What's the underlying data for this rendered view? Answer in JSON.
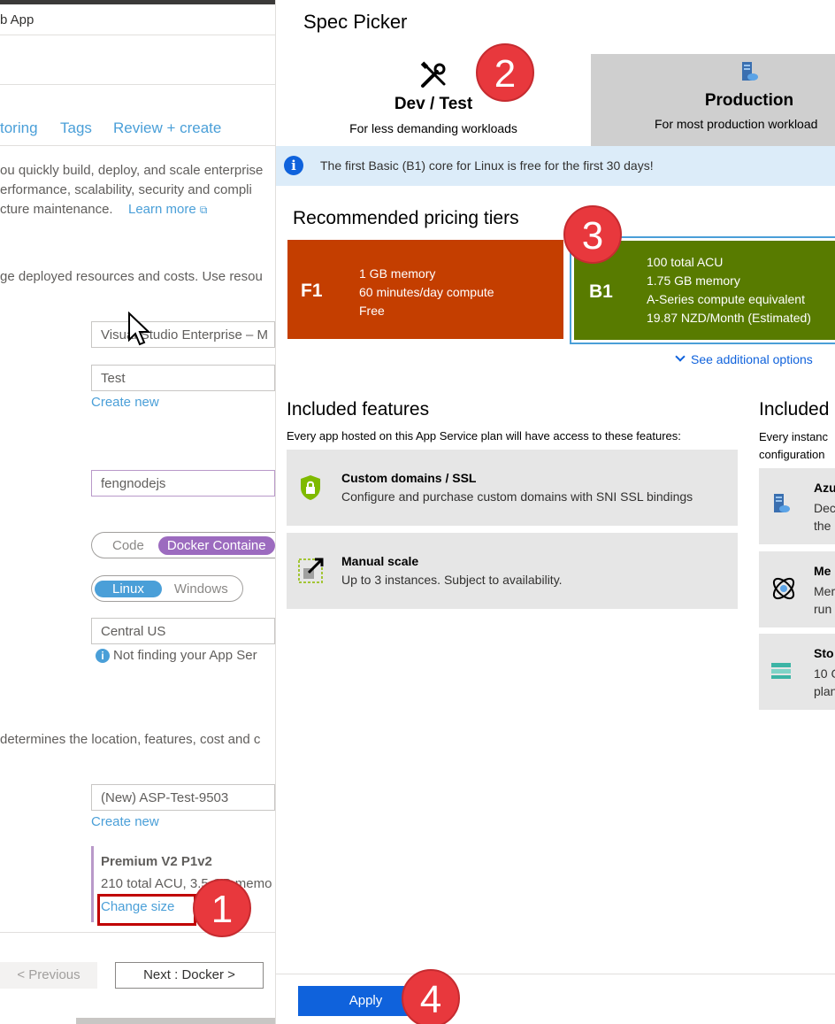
{
  "background": {
    "title_fragment": "b App",
    "tabs": [
      "toring",
      "Tags",
      "Review + create"
    ],
    "description": [
      "ou quickly build, deploy, and scale enterprise",
      "erformance, scalability, security and compli",
      "cture maintenance."
    ],
    "learn_more": "Learn more",
    "resources_text": "ge deployed resources and costs. Use resou",
    "subscription_value": "Visual Studio Enterprise – M",
    "resource_group_value": "Test",
    "create_new_label": "Create new",
    "name_value": "fengnodejs",
    "publish_options": [
      "Code",
      "Docker Containe"
    ],
    "os_options": [
      "Linux",
      "Windows"
    ],
    "region_value": "Central US",
    "region_hint": "Not finding your App Ser",
    "plan_text": "determines the location, features, cost and c",
    "plan_value": "(New) ASP-Test-9503",
    "sku_name": "Premium V2 P1v2",
    "sku_detail": "210 total ACU, 3.5 GB memo",
    "change_size": "Change size",
    "previous_button": "< Previous",
    "next_button": "Next : Docker >"
  },
  "panel": {
    "title": "Spec Picker",
    "tabs": [
      {
        "label": "Dev / Test",
        "subtitle": "For less demanding workloads",
        "icon": "tools-icon"
      },
      {
        "label": "Production",
        "subtitle": "For most production workload",
        "icon": "server-icon"
      }
    ],
    "info_banner": "The first Basic (B1) core for Linux is free for the first 30 days!",
    "recommended_heading": "Recommended pricing tiers",
    "tiers": [
      {
        "code": "F1",
        "lines": [
          "1 GB memory",
          "60 minutes/day compute",
          "Free"
        ],
        "color": "#c43e00"
      },
      {
        "code": "B1",
        "lines": [
          "100 total ACU",
          "1.75 GB memory",
          "A-Series compute equivalent",
          "19.87 NZD/Month (Estimated)"
        ],
        "color": "#587b00"
      }
    ],
    "see_more": "See additional options",
    "features_heading": "Included features",
    "features_subtitle": "Every app hosted on this App Service plan will have access to these features:",
    "features": [
      {
        "title": "Custom domains / SSL",
        "desc": "Configure and purchase custom domains with SNI SSL bindings",
        "icon": "shield-lock-icon"
      },
      {
        "title": "Manual scale",
        "desc": "Up to 3 instances. Subject to availability.",
        "icon": "scale-icon"
      }
    ],
    "hardware_heading": "Included",
    "hardware_subtitle": [
      "Every instanc",
      "configuration"
    ],
    "hardware": [
      {
        "title": "Azu",
        "desc": [
          "Dec",
          "the"
        ],
        "icon": "server-icon"
      },
      {
        "title": "Me",
        "desc": [
          "Mer",
          "run"
        ],
        "icon": "memory-icon"
      },
      {
        "title": "Sto",
        "desc": [
          "10 G",
          "plan"
        ],
        "icon": "storage-icon"
      }
    ],
    "apply_button": "Apply"
  },
  "callouts": [
    "1",
    "2",
    "3",
    "4"
  ],
  "colors": {
    "accent": "#0f62dc",
    "link": "#4a9fd8",
    "callout": "#e8383d",
    "info_bg": "#dcecf9"
  }
}
